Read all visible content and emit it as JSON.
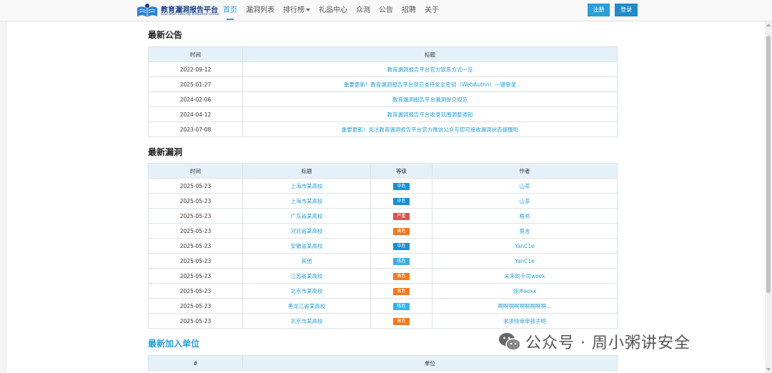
{
  "header": {
    "logo_title": "教育漏洞报告平台",
    "logo_subtitle": "Education Security Response Center",
    "nav": [
      {
        "label": "首页",
        "active": true
      },
      {
        "label": "漏洞列表"
      },
      {
        "label": "排行榜",
        "dropdown": true
      },
      {
        "label": "礼品中心"
      },
      {
        "label": "众测"
      },
      {
        "label": "公告"
      },
      {
        "label": "招聘"
      },
      {
        "label": "关于"
      }
    ],
    "register_label": "注册",
    "login_label": "登录"
  },
  "announcements": {
    "title": "最新公告",
    "columns": [
      "时间",
      "标题"
    ],
    "rows": [
      {
        "date": "2022-09-12",
        "title": "教育漏洞报告平台官方联系方式一览"
      },
      {
        "date": "2025-01-27",
        "title": "重要更新！教育漏洞报告平台现已支持安全密钥（WebAuthn）一键登录"
      },
      {
        "date": "2024-02-06",
        "title": "教育漏洞报告平台漏洞提交规范"
      },
      {
        "date": "2024-04-12",
        "title": "教育漏洞报告平台收录范围调整通知"
      },
      {
        "date": "2023-07-08",
        "title": "重要更新！关注教育漏洞报告平台官方微信公众号即可接收漏洞状态提醒啦"
      }
    ]
  },
  "vulns": {
    "title": "最新漏洞",
    "columns": [
      "时间",
      "标题",
      "等级",
      "作者"
    ],
    "rows": [
      {
        "date": "2025-05-23",
        "title": "上海市某高校",
        "level": "中危",
        "level_class": "zh",
        "author": "山茶"
      },
      {
        "date": "2025-05-23",
        "title": "上海市某高校",
        "level": "中危",
        "level_class": "zh",
        "author": "山茶"
      },
      {
        "date": "2025-05-23",
        "title": "广东省某高校",
        "level": "严重",
        "level_class": "yz",
        "author": "梧祁"
      },
      {
        "date": "2025-05-23",
        "title": "河北省某高校",
        "level": "高危",
        "level_class": "gw",
        "author": "莫言"
      },
      {
        "date": "2025-05-23",
        "title": "安徽省某高校",
        "level": "中危",
        "level_class": "zh",
        "author": "YanC1e"
      },
      {
        "date": "2025-05-23",
        "title": "其他",
        "level": "低危",
        "level_class": "dw",
        "author": "YanC1e"
      },
      {
        "date": "2025-05-23",
        "title": "江苏省某高校",
        "level": "高危",
        "level_class": "gw",
        "author": "未来的卡司week"
      },
      {
        "date": "2025-05-23",
        "title": "北京市某高校",
        "level": "高危",
        "level_class": "gw",
        "author": "快冲ooxx"
      },
      {
        "date": "2025-05-23",
        "title": "黑龙江省某高校",
        "level": "低危",
        "level_class": "dw",
        "author": "啊啊啊啊啊啊啊啊啊…"
      },
      {
        "date": "2025-05-23",
        "title": "北京市某高校",
        "level": "高危",
        "level_class": "gw",
        "author": "求求快审审孩子吧"
      }
    ]
  },
  "units": {
    "title": "最新加入单位",
    "columns": [
      "#",
      "单位"
    ]
  },
  "watermark": {
    "text": "公众号 · 周小粥讲安全",
    "icon": "wechat-icon"
  },
  "colors": {
    "accent": "#2a9fd6",
    "badge_zh": "#1a8fd0",
    "badge_yz": "#d9534f",
    "badge_gw": "#ee7a22",
    "badge_dw": "#3ab0e4"
  }
}
